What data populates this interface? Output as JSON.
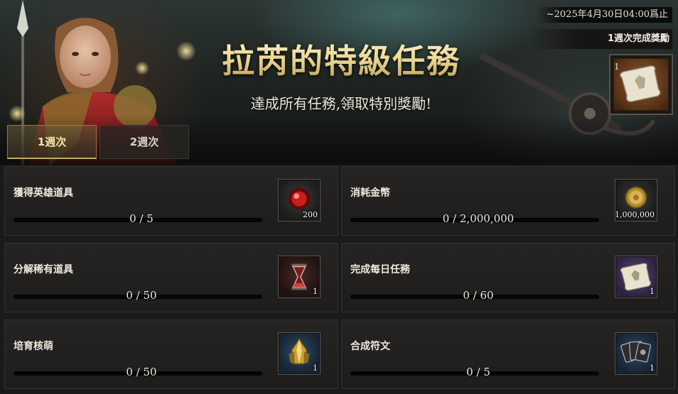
{
  "event": {
    "deadline": "~2025年4月30日04:00爲止",
    "title": "拉芮的特級任務",
    "subtitle": "達成所有任務,領取特別獎勵!",
    "weekly_reward_label": "1週次完成獎勵",
    "weekly_reward_qty": "1",
    "weekly_reward_icon": "scroll-icon"
  },
  "tabs": [
    {
      "label": "1週次",
      "active": true
    },
    {
      "label": "2週次",
      "active": false
    }
  ],
  "tasks": [
    {
      "name": "獲得英雄道具",
      "progress_text": "0 / 5",
      "progress": 0,
      "reward_qty": "200",
      "reward_icon": "red-gem-icon"
    },
    {
      "name": "消耗金幣",
      "progress_text": "0 / 2,000,000",
      "progress": 0,
      "reward_qty": "1,000,000",
      "reward_icon": "gold-coin-icon"
    },
    {
      "name": "分解稀有道具",
      "progress_text": "0 / 50",
      "progress": 0,
      "reward_qty": "1",
      "reward_icon": "hourglass-icon"
    },
    {
      "name": "完成每日任務",
      "progress_text": "0 / 60",
      "progress": 0,
      "reward_qty": "1",
      "reward_icon": "scroll-icon"
    },
    {
      "name": "培育核萌",
      "progress_text": "0 / 50",
      "progress": 0,
      "reward_qty": "1",
      "reward_icon": "crystal-icon"
    },
    {
      "name": "合成符文",
      "progress_text": "0 / 5",
      "progress": 0,
      "reward_qty": "1",
      "reward_icon": "rune-cards-icon"
    }
  ],
  "colors": {
    "accent_gold": "#c9a859",
    "card_bg": "#232220",
    "tab_active_text": "#f4e4a8"
  }
}
